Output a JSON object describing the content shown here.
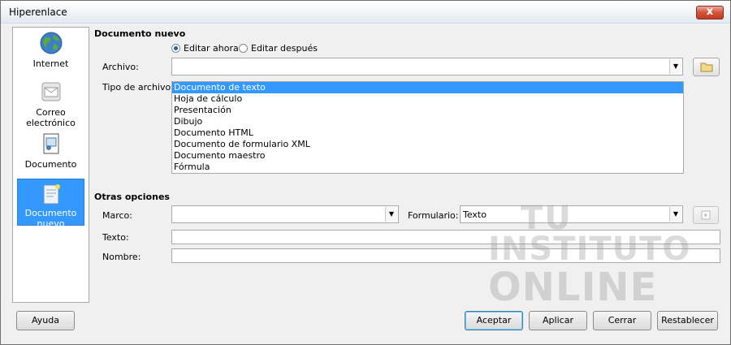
{
  "window": {
    "title": "Hiperenlace",
    "close_glyph": "x"
  },
  "sidebar": {
    "items": [
      {
        "label": "Internet",
        "icon": "globe-icon"
      },
      {
        "label": "Correo electrónico",
        "icon": "mail-icon"
      },
      {
        "label": "Documento",
        "icon": "document-icon"
      },
      {
        "label": "Documento nuevo",
        "icon": "new-document-icon",
        "selected": true
      }
    ]
  },
  "new_document": {
    "section_title": "Documento nuevo",
    "edit_now_label": "Editar ahora",
    "edit_later_label": "Editar después",
    "edit_now_selected": true,
    "file_label": "Archivo:",
    "file_value": "",
    "file_type_label": "Tipo de archivo:",
    "file_types": [
      "Documento de texto",
      "Hoja de cálculo",
      "Presentación",
      "Dibujo",
      "Documento HTML",
      "Documento de formulario XML",
      "Documento maestro",
      "Fórmula"
    ],
    "selected_file_type": "Documento de texto"
  },
  "other_options": {
    "section_title": "Otras opciones",
    "frame_label": "Marco:",
    "frame_value": "",
    "form_label": "Formulario:",
    "form_value": "Texto",
    "text_label": "Texto:",
    "text_value": "",
    "name_label": "Nombre:",
    "name_value": ""
  },
  "buttons": {
    "help": "Ayuda",
    "ok": "Aceptar",
    "apply": "Aplicar",
    "close": "Cerrar",
    "reset": "Restablecer"
  },
  "watermark": {
    "line1": "TU",
    "line2": "INSTITUTO",
    "line3": "ONLINE"
  },
  "colors": {
    "selection": "#3399ff",
    "close_button": "#c7432a"
  }
}
